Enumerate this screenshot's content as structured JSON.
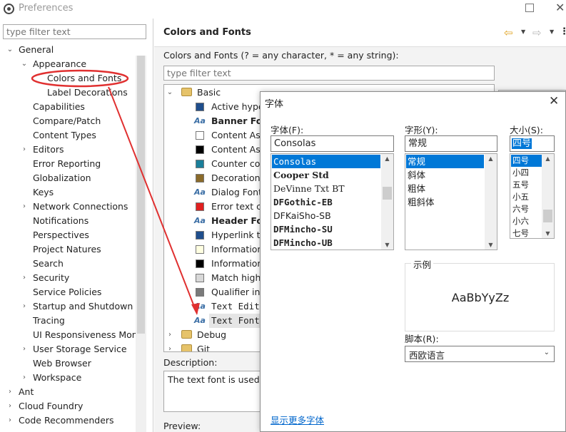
{
  "window": {
    "title": "Preferences"
  },
  "left": {
    "filter_placeholder": "type filter text",
    "tree": [
      {
        "label": "General",
        "twisty": "⌄",
        "level": 0
      },
      {
        "label": "Appearance",
        "twisty": "⌄",
        "level": 1
      },
      {
        "label": "Colors and Fonts",
        "twisty": "",
        "level": 2
      },
      {
        "label": "Label Decorations",
        "twisty": "",
        "level": 2
      },
      {
        "label": "Capabilities",
        "twisty": "",
        "level": 1
      },
      {
        "label": "Compare/Patch",
        "twisty": "",
        "level": 1
      },
      {
        "label": "Content Types",
        "twisty": "",
        "level": 1
      },
      {
        "label": "Editors",
        "twisty": "›",
        "level": 1
      },
      {
        "label": "Error Reporting",
        "twisty": "",
        "level": 1
      },
      {
        "label": "Globalization",
        "twisty": "",
        "level": 1
      },
      {
        "label": "Keys",
        "twisty": "",
        "level": 1
      },
      {
        "label": "Network Connections",
        "twisty": "›",
        "level": 1
      },
      {
        "label": "Notifications",
        "twisty": "",
        "level": 1
      },
      {
        "label": "Perspectives",
        "twisty": "",
        "level": 1
      },
      {
        "label": "Project Natures",
        "twisty": "",
        "level": 1
      },
      {
        "label": "Search",
        "twisty": "",
        "level": 1
      },
      {
        "label": "Security",
        "twisty": "›",
        "level": 1
      },
      {
        "label": "Service Policies",
        "twisty": "",
        "level": 1
      },
      {
        "label": "Startup and Shutdown",
        "twisty": "›",
        "level": 1
      },
      {
        "label": "Tracing",
        "twisty": "",
        "level": 1
      },
      {
        "label": "UI Responsiveness Mon",
        "twisty": "",
        "level": 1
      },
      {
        "label": "User Storage Service",
        "twisty": "›",
        "level": 1
      },
      {
        "label": "Web Browser",
        "twisty": "",
        "level": 1
      },
      {
        "label": "Workspace",
        "twisty": "›",
        "level": 1
      },
      {
        "label": "Ant",
        "twisty": "›",
        "level": 0
      },
      {
        "label": "Cloud Foundry",
        "twisty": "›",
        "level": 0
      },
      {
        "label": "Code Recommenders",
        "twisty": "›",
        "level": 0
      }
    ]
  },
  "right": {
    "page_title": "Colors and Fonts",
    "nav": {
      "back_icon": "back-arrow-icon",
      "forward_icon": "forward-arrow-icon",
      "menu_icon": "view-menu-icon",
      "back_color": "#e0a320",
      "forward_color": "#b9b9b9"
    },
    "hint": "Colors and Fonts (? = any character, * = any string):",
    "filter_placeholder": "type filter text",
    "tree": [
      {
        "kind": "folder",
        "label": "Basic",
        "twisty": "⌄",
        "indent": 0
      },
      {
        "kind": "color",
        "label": "Active hyperl",
        "color": "#1f4e8c",
        "indent": 1
      },
      {
        "kind": "font",
        "label": "Banner Font",
        "bold": true,
        "indent": 1
      },
      {
        "kind": "color",
        "label": "Content Assi",
        "color": "#ffffff",
        "indent": 1
      },
      {
        "kind": "color",
        "label": "Content Assi",
        "color": "#000000",
        "indent": 1
      },
      {
        "kind": "color",
        "label": "Counter colo",
        "color": "#1a7f9a",
        "indent": 1
      },
      {
        "kind": "color",
        "label": "Decoration c",
        "color": "#8a6a2a",
        "indent": 1
      },
      {
        "kind": "font",
        "label": "Dialog Font",
        "bold": false,
        "indent": 1
      },
      {
        "kind": "color",
        "label": "Error text co",
        "color": "#e02020",
        "indent": 1
      },
      {
        "kind": "font",
        "label": "Header Font",
        "bold": true,
        "indent": 1
      },
      {
        "kind": "color",
        "label": "Hyperlink tex",
        "color": "#1f4e8c",
        "indent": 1
      },
      {
        "kind": "color",
        "label": "Information",
        "color": "#ffffe1",
        "indent": 1
      },
      {
        "kind": "color",
        "label": "Information",
        "color": "#000000",
        "indent": 1
      },
      {
        "kind": "color",
        "label": "Match highli",
        "color": "#d8d8d8",
        "indent": 1
      },
      {
        "kind": "color",
        "label": "Qualifier info",
        "color": "#7a7a7a",
        "indent": 1
      },
      {
        "kind": "font",
        "label": "Text Editor",
        "bold": false,
        "mono": true,
        "indent": 1
      },
      {
        "kind": "font",
        "label": "Text Font",
        "bold": false,
        "mono": true,
        "selected": true,
        "indent": 1
      },
      {
        "kind": "folder",
        "label": "Debug",
        "twisty": "›",
        "indent": 0
      },
      {
        "kind": "folder",
        "label": "Git",
        "twisty": "›",
        "indent": 0
      }
    ],
    "description_label": "Description:",
    "description_text": "The text font is used by",
    "preview_label": "Preview:"
  },
  "font_dialog": {
    "title": "字体",
    "font_label": "字体(F):",
    "font_value": "Consolas",
    "fonts": [
      "Consolas",
      "Cooper Std",
      "DeVinne Txt BT",
      "DFGothic-EB",
      "DFKaiSho-SB",
      "DFMincho-SU",
      "DFMincho-UB"
    ],
    "style_label": "字形(Y):",
    "style_value": "常规",
    "styles": [
      "常规",
      "斜体",
      "粗体",
      "粗斜体"
    ],
    "size_label": "大小(S):",
    "size_value": "四号",
    "sizes": [
      "四号",
      "小四",
      "五号",
      "小五",
      "六号",
      "小六",
      "七号"
    ],
    "sample_label": "示例",
    "sample_text": "AaBbYyZz",
    "script_label": "脚本(R):",
    "script_value": "西欧语言",
    "more_fonts_link": "显示更多字体"
  },
  "annotation": {
    "color": "#e03030"
  }
}
